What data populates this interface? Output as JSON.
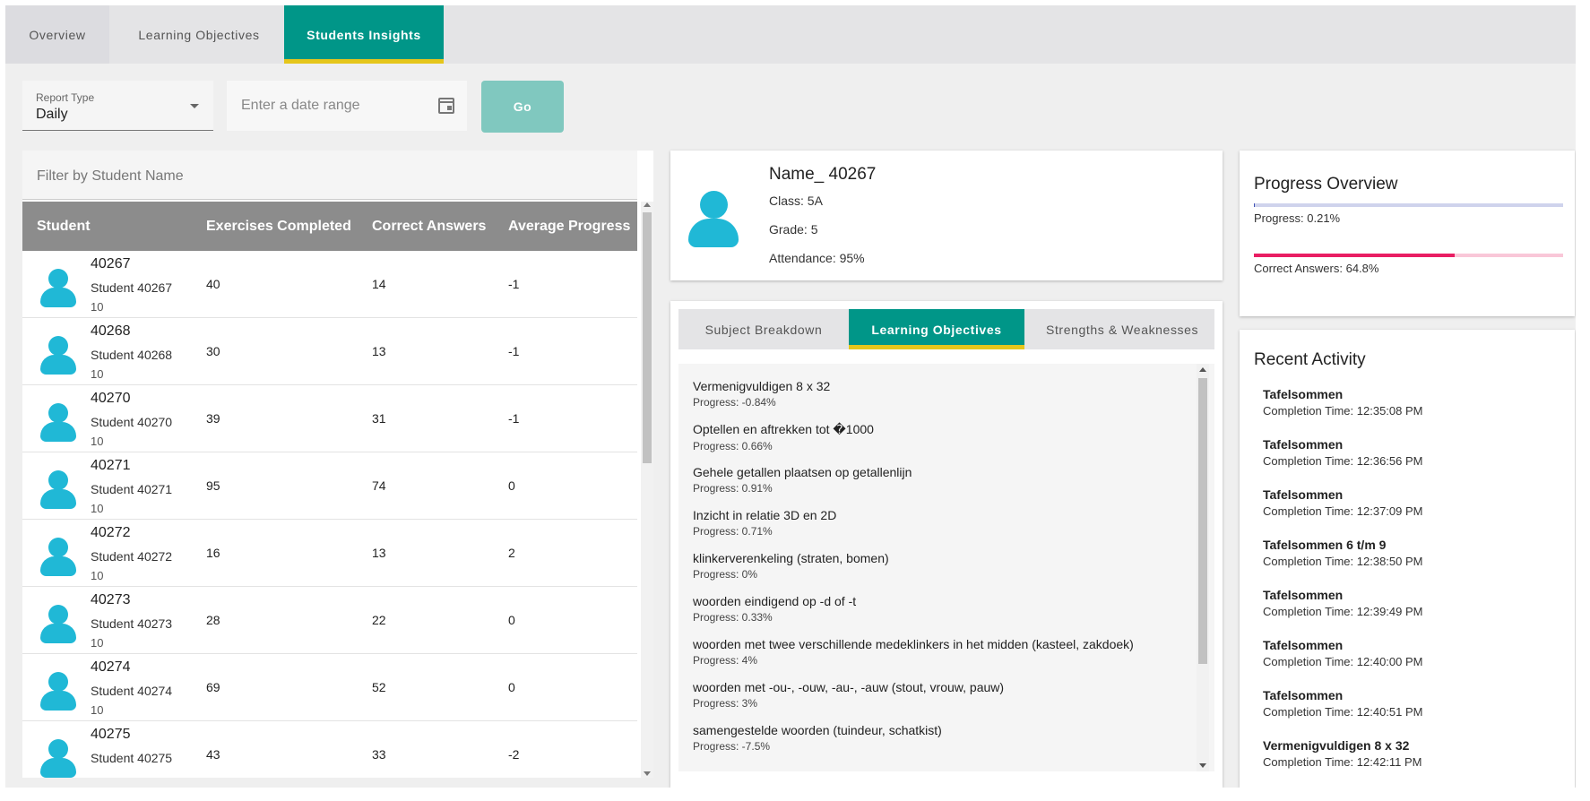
{
  "tabs": {
    "overview": "Overview",
    "learning_objectives": "Learning Objectives",
    "students_insights": "Students Insights"
  },
  "filters": {
    "report_type_label": "Report Type",
    "report_type_value": "Daily",
    "date_placeholder": "Enter a date range",
    "go_label": "Go"
  },
  "student_table": {
    "filter_placeholder": "Filter by Student Name",
    "columns": [
      "Student",
      "Exercises Completed",
      "Correct Answers",
      "Average Progress"
    ],
    "rows": [
      {
        "id": "40267",
        "name": "Student 40267",
        "grade": "10",
        "exercises": "40",
        "correct": "14",
        "progress": "-1"
      },
      {
        "id": "40268",
        "name": "Student 40268",
        "grade": "10",
        "exercises": "30",
        "correct": "13",
        "progress": "-1"
      },
      {
        "id": "40270",
        "name": "Student 40270",
        "grade": "10",
        "exercises": "39",
        "correct": "31",
        "progress": "-1"
      },
      {
        "id": "40271",
        "name": "Student 40271",
        "grade": "10",
        "exercises": "95",
        "correct": "74",
        "progress": "0"
      },
      {
        "id": "40272",
        "name": "Student 40272",
        "grade": "10",
        "exercises": "16",
        "correct": "13",
        "progress": "2"
      },
      {
        "id": "40273",
        "name": "Student 40273",
        "grade": "10",
        "exercises": "28",
        "correct": "22",
        "progress": "0"
      },
      {
        "id": "40274",
        "name": "Student 40274",
        "grade": "10",
        "exercises": "69",
        "correct": "52",
        "progress": "0"
      },
      {
        "id": "40275",
        "name": "Student 40275",
        "grade": "",
        "exercises": "43",
        "correct": "33",
        "progress": "-2"
      }
    ]
  },
  "profile": {
    "name": "Name_ 40267",
    "class": "Class: 5A",
    "grade": "Grade: 5",
    "attendance": "Attendance: 95%"
  },
  "detail_tabs": {
    "subject_breakdown": "Subject Breakdown",
    "learning_objectives": "Learning Objectives",
    "strengths": "Strengths & Weaknesses"
  },
  "objectives": [
    {
      "title": "Vermenigvuldigen 8 x 32",
      "progress": "Progress: -0.84%"
    },
    {
      "title": "Optellen en aftrekken tot �1000",
      "progress": "Progress: 0.66%"
    },
    {
      "title": "Gehele getallen plaatsen op getallenlijn",
      "progress": "Progress: 0.91%"
    },
    {
      "title": "Inzicht in relatie 3D en 2D",
      "progress": "Progress: 0.71%"
    },
    {
      "title": "klinkerverenkeling (straten, bomen)",
      "progress": "Progress: 0%"
    },
    {
      "title": "woorden eindigend op -d of -t",
      "progress": "Progress: 0.33%"
    },
    {
      "title": "woorden met twee verschillende medeklinkers in het midden (kasteel, zakdoek)",
      "progress": "Progress: 4%"
    },
    {
      "title": "woorden met -ou-, -ouw, -au-, -auw (stout, vrouw, pauw)",
      "progress": "Progress: 3%"
    },
    {
      "title": "samengestelde woorden (tuindeur, schatkist)",
      "progress": "Progress: -7.5%"
    }
  ],
  "progress_overview": {
    "title": "Progress Overview",
    "progress_label": "Progress: 0.21%",
    "progress_fraction": 0.0021,
    "correct_label": "Correct Answers: 64.8%",
    "correct_fraction": 0.648,
    "progress_color": "#3f51b5",
    "correct_color": "#e91e63"
  },
  "recent_activity": {
    "title": "Recent Activity",
    "items": [
      {
        "title": "Tafelsommen",
        "time": "Completion Time: 12:35:08 PM"
      },
      {
        "title": "Tafelsommen",
        "time": "Completion Time: 12:36:56 PM"
      },
      {
        "title": "Tafelsommen",
        "time": "Completion Time: 12:37:09 PM"
      },
      {
        "title": "Tafelsommen 6 t/m 9",
        "time": "Completion Time: 12:38:50 PM"
      },
      {
        "title": "Tafelsommen",
        "time": "Completion Time: 12:39:49 PM"
      },
      {
        "title": "Tafelsommen",
        "time": "Completion Time: 12:40:00 PM"
      },
      {
        "title": "Tafelsommen",
        "time": "Completion Time: 12:40:51 PM"
      },
      {
        "title": "Vermenigvuldigen 8 x 32",
        "time": "Completion Time: 12:42:11 PM"
      }
    ]
  },
  "colors": {
    "accent": "#009688",
    "tab_indicator": "#e5c61b",
    "avatar": "#20b8d6",
    "header_gray": "#8c8c8c"
  }
}
